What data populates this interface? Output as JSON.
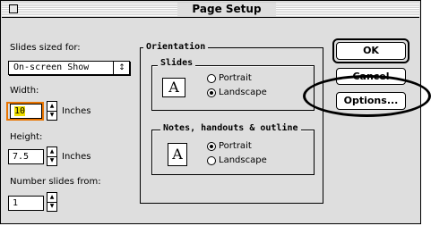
{
  "window": {
    "title": "Page Setup"
  },
  "slides_sized_for": {
    "label": "Slides sized for:",
    "value": "On-screen Show"
  },
  "width": {
    "label": "Width:",
    "value": "10",
    "unit": "Inches"
  },
  "height": {
    "label": "Height:",
    "value": "7.5",
    "unit": "Inches"
  },
  "number_from": {
    "label": "Number slides from:",
    "value": "1"
  },
  "orientation": {
    "title": "Orientation",
    "slides": {
      "title": "Slides",
      "icon_letter": "A",
      "options": [
        "Portrait",
        "Landscape"
      ],
      "selected": "Landscape"
    },
    "notes": {
      "title": "Notes, handouts & outline",
      "icon_letter": "A",
      "options": [
        "Portrait",
        "Landscape"
      ],
      "selected": "Portrait"
    }
  },
  "buttons": {
    "ok": "OK",
    "cancel": "Cancel",
    "options": "Options..."
  },
  "icons": [
    "close-box-icon",
    "popup-arrow-icon",
    "stepper-icon",
    "page-icon",
    "highlight-ellipse"
  ]
}
